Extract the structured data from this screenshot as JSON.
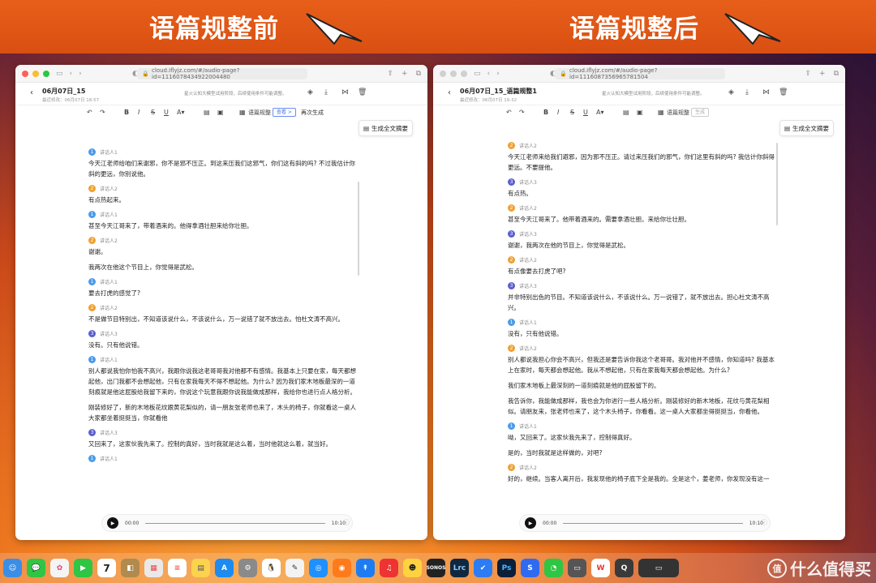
{
  "banner": {
    "left_title": "语篇规整前",
    "right_title": "语篇规整后"
  },
  "left": {
    "url": "cloud.iflyjz.com/#/audio-page?id=1116078434922004480",
    "title": "06月07日_15",
    "subtitle": "最近修改：06月07日 18:57",
    "notice": "星火认知大模型试用阶段，后续使用条件可能调整。",
    "toolbar": {
      "regularize": "语篇规整",
      "view": "查看 >",
      "regen": "再次生成"
    },
    "summary": "生成全文摘要",
    "entries": [
      {
        "n": "1",
        "speaker": "讲话人1",
        "color": "#4a9be8",
        "paras": [
          "今天江老师给咱们来谢邪，你不是邪不压正。到这来压我们这邪气，你们这有斜的吗? 不过我估计你斜的更远，你别说他。"
        ]
      },
      {
        "n": "2",
        "speaker": "讲话人2",
        "color": "#f0a030",
        "paras": [
          "有点热起来。"
        ]
      },
      {
        "n": "1",
        "speaker": "讲话人1",
        "color": "#4a9be8",
        "paras": [
          "甚至今天江哥来了，带着酒来的。他得拿酒壮胆来给你壮胆。"
        ]
      },
      {
        "n": "2",
        "speaker": "讲话人2",
        "color": "#f0a030",
        "paras": [
          "谢谢。",
          "我两次在他这个节目上，你觉得是武松。"
        ]
      },
      {
        "n": "1",
        "speaker": "讲话人1",
        "color": "#4a9be8",
        "paras": [
          "要去打虎的感觉了?"
        ]
      },
      {
        "n": "2",
        "speaker": "讲话人2",
        "color": "#f0a030",
        "paras": [
          "不是做节目特别出，不知道该说什么，不该说什么，万一说错了就不放出去。怕杜文涛不高兴。"
        ]
      },
      {
        "n": "3",
        "speaker": "讲话人3",
        "color": "#5a5fd0",
        "paras": [
          "没有。只有他说错。"
        ]
      },
      {
        "n": "1",
        "speaker": "讲话人1",
        "color": "#4a9be8",
        "paras": [
          "别人都说我怕你怕我不高兴，我跟你说我这老哥哥我对他都不有感情。我基本上只要在家，每天都想起他，出门我都不会想起他，只有在家我每天不得不想起他。为什么? 因为我们家木地板最深的一道刻痕就是他这屁股给我留下来的，你说这个玩意我跟你说我能做成那样，我给你也进行点人格分析。",
          "刚装修好了，新的木地板花纹跟黄花梨似的，请一朋友张老师也来了，木头的椅子，你就看这一桌人大家都坐着挺挺当，你就看他"
        ]
      },
      {
        "n": "3",
        "speaker": "讲话人3",
        "color": "#5a5fd0",
        "paras": [
          "又回来了，这家伙我先来了。控制的真好，当时我就是这么着，当时他就这么着，就当好。"
        ]
      },
      {
        "n": "1",
        "speaker": "讲话人1",
        "color": "#4a9be8",
        "paras": []
      }
    ],
    "player": {
      "start": "00:00",
      "end": "10:10"
    }
  },
  "right": {
    "url": "cloud.iflyjz.com/#/audio-page?id=1116087356965781504",
    "title": "06月07日_15_语篇规整1",
    "subtitle": "最近修改：06月07日 19:32",
    "notice": "星火认知大模型试用阶段，后续使用条件可能调整。",
    "toolbar": {
      "regularize": "语篇规整",
      "gen": "生成"
    },
    "summary": "生成全文摘要",
    "entries": [
      {
        "n": "2",
        "speaker": "讲话人2",
        "color": "#f0a030",
        "paras": [
          "今天江老师来给我们避邪，因为邪不压正。请过来压我们的邪气，你们这里有斜的吗? 我估计你斜得更远。不要提他。"
        ]
      },
      {
        "n": "3",
        "speaker": "讲话人3",
        "color": "#5a5fd0",
        "paras": [
          "有点热。"
        ]
      },
      {
        "n": "2",
        "speaker": "讲话人2",
        "color": "#f0a030",
        "paras": [
          "甚至今天江哥来了。他带着酒来的。需要拿酒壮胆。来给你壮壮胆。"
        ]
      },
      {
        "n": "3",
        "speaker": "讲话人3",
        "color": "#5a5fd0",
        "paras": [
          "谢谢，我两次在他的节目上，你觉得是武松。"
        ]
      },
      {
        "n": "2",
        "speaker": "讲话人2",
        "color": "#f0a030",
        "paras": [
          "有点像要去打虎了吧?"
        ]
      },
      {
        "n": "3",
        "speaker": "讲话人3",
        "color": "#5a5fd0",
        "paras": [
          "并非特别出色的节目。不知道该说什么，不该说什么。万一说错了，就不放出去。担心杜文涛不高兴。"
        ]
      },
      {
        "n": "1",
        "speaker": "讲话人1",
        "color": "#4a9be8",
        "paras": [
          "没有，只有他说错。"
        ]
      },
      {
        "n": "2",
        "speaker": "讲话人2",
        "color": "#f0a030",
        "paras": [
          "别人都说我担心你会不高兴，但我还是要告诉你我这个老哥哥。我对他并不感情，你知道吗? 我基本上在家时，每天都会想起他。我从不想起他，只有在家我每天都会想起他。为什么?",
          "我们家木地板上最深刻的一道刻痕就是他的屁股留下的。",
          "我告诉你，我能做成那样，我也会为你进行一些人格分析。刚装修好的新木地板，花纹与黄花梨相似。请朋友来，张老师也来了，这个木头椅子，你看看。这一桌人大家都坐得挺挺当，你看他。"
        ]
      },
      {
        "n": "1",
        "speaker": "讲话人1",
        "color": "#4a9be8",
        "paras": [
          "呦，又回来了。这家伙我先来了，控制得真好。",
          "是的，当时我就是这样做的，对吧?"
        ]
      },
      {
        "n": "2",
        "speaker": "讲话人2",
        "color": "#f0a030",
        "paras": [
          "好的，继续。当客人离开后，我发现他的椅子底下全是我的。全是这个，姜老师，你发现没有这一"
        ]
      }
    ],
    "player": {
      "start": "00:00",
      "end": "10:10"
    }
  },
  "dock": {
    "calendar_day": "7",
    "watermark": "什么值得买",
    "watermark_icon": "值"
  }
}
